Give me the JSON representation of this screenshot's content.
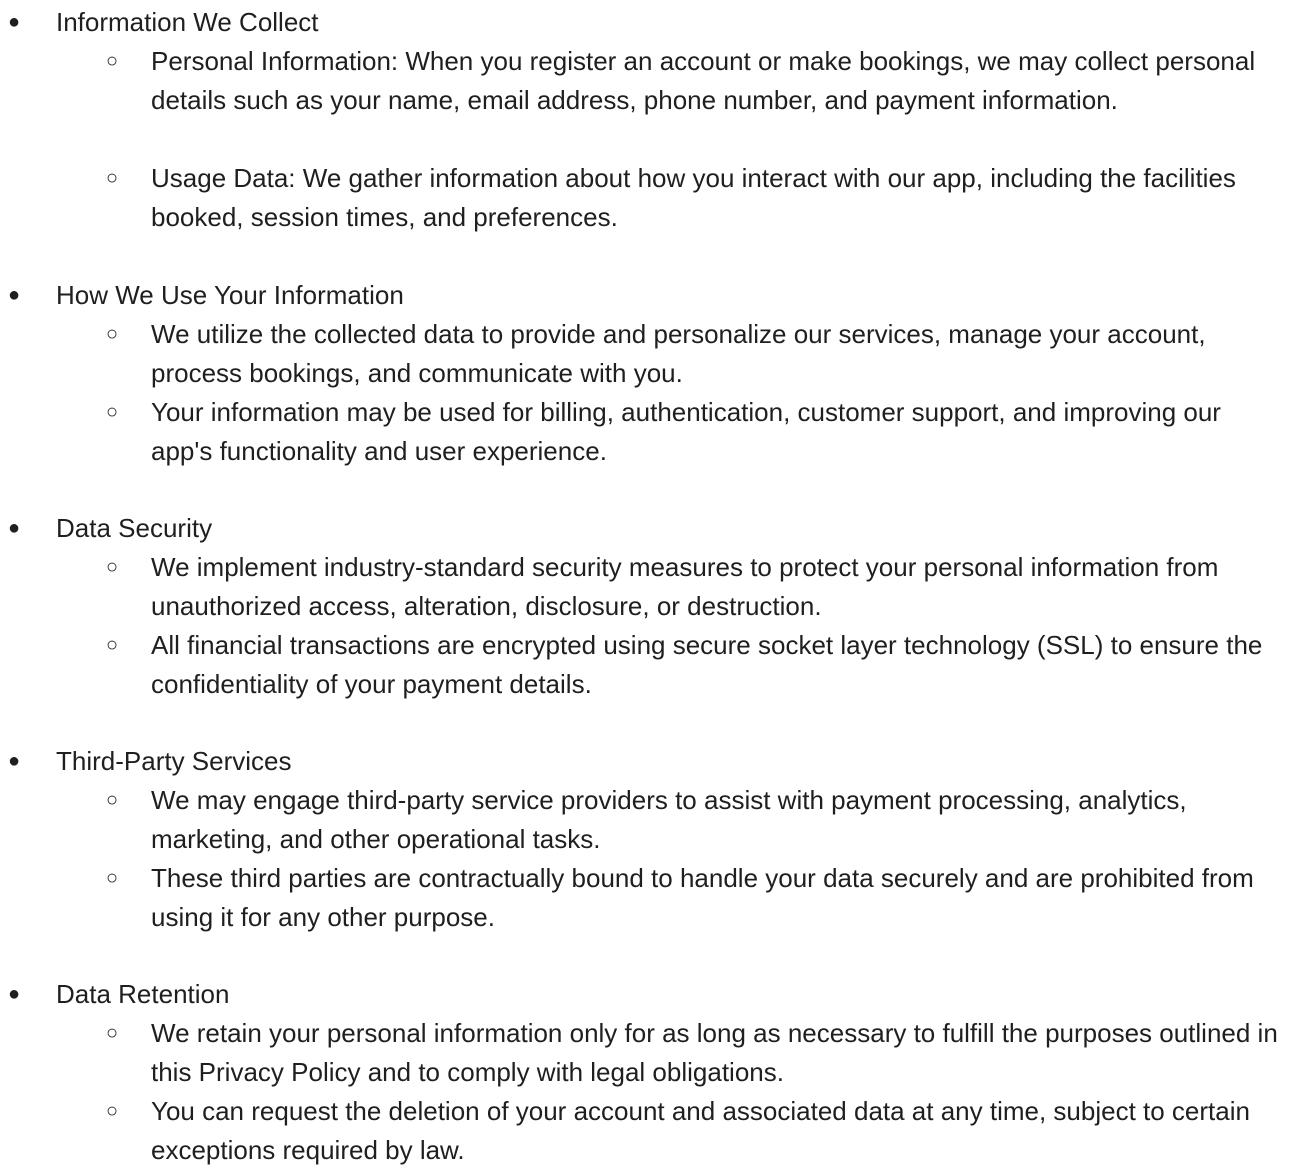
{
  "bullet_glyph": "●",
  "sub_bullet_glyph": "○",
  "sections": [
    {
      "heading": "Information We Collect",
      "items": [
        "Personal Information: When you register an account or make bookings, we may collect personal details such as your name, email address, phone number, and payment information.",
        "Usage Data: We gather information about how you interact with our app, including the facilities booked, session times, and preferences."
      ]
    },
    {
      "heading": "How We Use Your Information",
      "items": [
        "We utilize the collected data to provide and personalize our services, manage your account, process bookings, and communicate with you.",
        "Your information may be used for billing, authentication, customer support, and improving our app's functionality and user experience."
      ]
    },
    {
      "heading": "Data Security",
      "items": [
        "We implement industry-standard security measures to protect your personal information from unauthorized access, alteration, disclosure, or destruction.",
        "All financial transactions are encrypted using secure socket layer technology (SSL) to ensure the confidentiality of your payment details."
      ]
    },
    {
      "heading": "Third-Party Services",
      "items": [
        "We may engage third-party service providers to assist with payment processing, analytics, marketing, and other operational tasks.",
        "These third parties are contractually bound to handle your data securely and are prohibited from using it for any other purpose."
      ]
    },
    {
      "heading": "Data Retention",
      "items": [
        "We retain your personal information only for as long as necessary to fulfill the purposes outlined in this Privacy Policy and to comply with legal obligations.",
        "You can request the deletion of your account and associated data at any time, subject to certain exceptions required by law."
      ]
    }
  ]
}
